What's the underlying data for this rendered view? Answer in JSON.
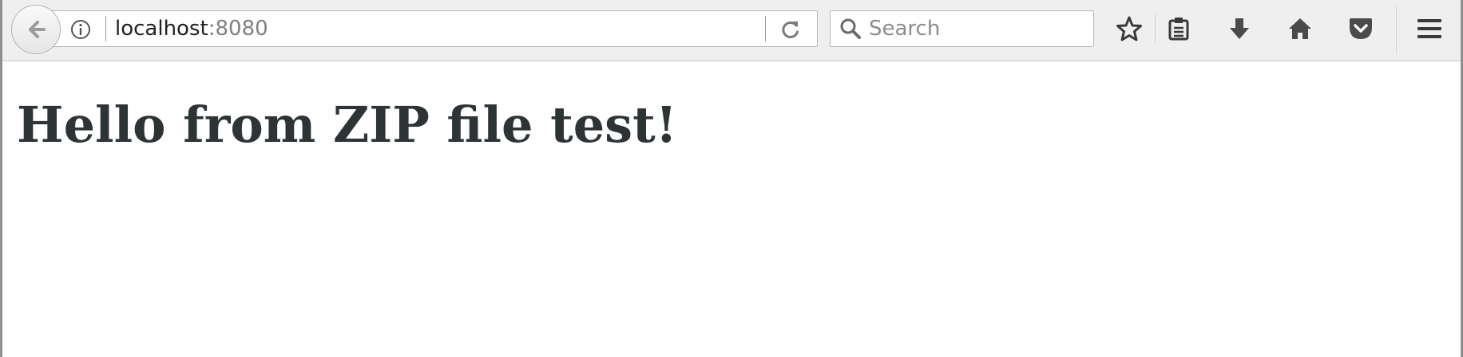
{
  "toolbar": {
    "back_icon": "back-arrow-icon",
    "url": {
      "info_icon": "info-icon",
      "host": "localhost",
      "port": ":8080",
      "reload_icon": "reload-icon"
    },
    "search": {
      "placeholder": "Search",
      "icon": "search-icon",
      "value": ""
    },
    "buttons": [
      "bookmark-star-icon",
      "reading-list-icon",
      "download-icon",
      "home-icon",
      "pocket-icon",
      "menu-icon"
    ]
  },
  "page": {
    "heading": "Hello from ZIP file test!"
  },
  "colors": {
    "toolbar_bg": "#efefef",
    "heading_text": "#2e3436",
    "icon": "#4a4a4a"
  }
}
